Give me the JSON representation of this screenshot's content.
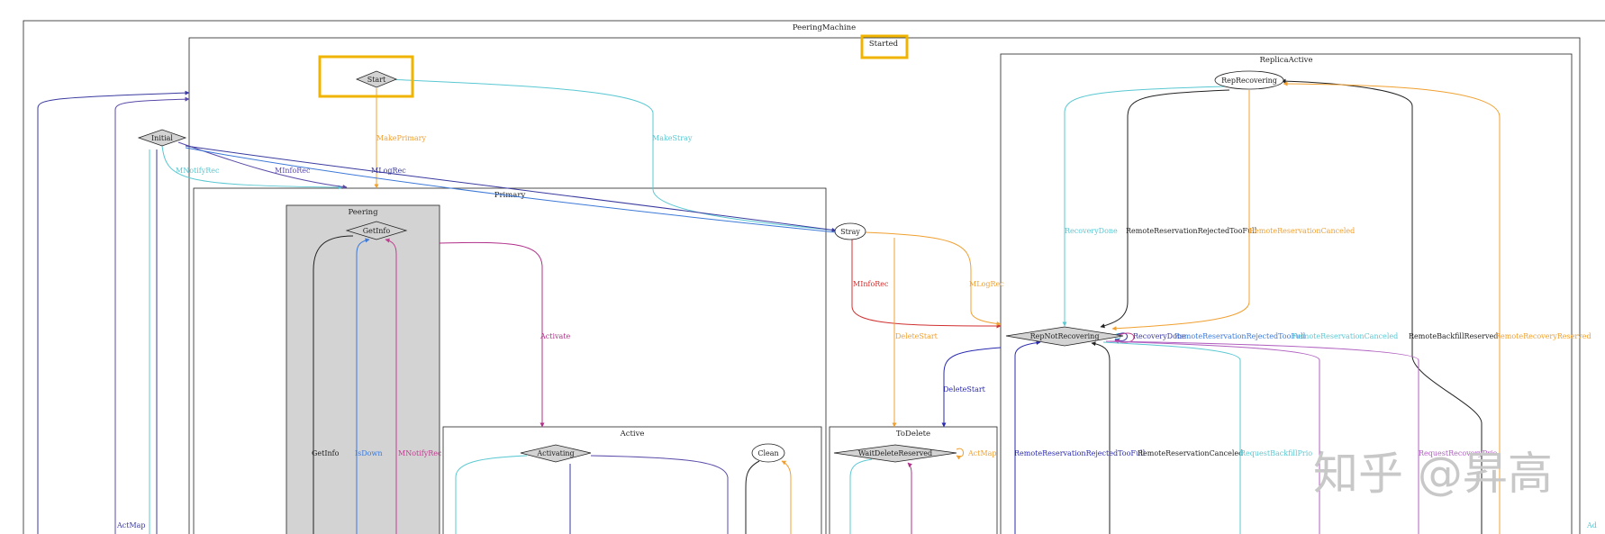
{
  "colors": {
    "highlight": "#f0b400",
    "cyan": "#5ac8d2",
    "orange": "#f0a030",
    "navy": "#3a3aa0",
    "purple": "#5a4aa8",
    "magenta": "#c03c90",
    "red": "#d03030",
    "black": "#222222",
    "blue": "#3c78d8",
    "gray_fill": "#d3d3d3",
    "violet": "#b060c0"
  },
  "clusters": {
    "peering_machine": "PeeringMachine",
    "started": "Started",
    "replica_active": "ReplicaActive",
    "primary": "Primary",
    "peering": "Peering",
    "active": "Active",
    "to_delete": "ToDelete"
  },
  "nodes": {
    "start": "Start",
    "initial": "Initial",
    "get_info": "GetInfo",
    "stray": "Stray",
    "rep_recovering": "RepRecovering",
    "rep_not_recovering": "RepNotRecovering",
    "activating": "Activating",
    "clean": "Clean",
    "wait_delete_reserved": "WaitDeleteReserved"
  },
  "edges": {
    "make_primary": "MakePrimary",
    "make_stray": "MakeStray",
    "mnotify_rec_initial": "MNotifyRec",
    "minfo_rec_initial": "MInfoRec",
    "mlog_rec_initial": "MLogRec",
    "activate": "Activate",
    "get_info_loop": "GetInfo",
    "is_down": "IsDown",
    "mnotify_rec_peering": "MNotifyRec",
    "minfo_rec_stray": "MInfoRec",
    "mlog_rec_stray": "MLogRec",
    "delete_start_stray": "DeleteStart",
    "delete_start_rep": "DeleteStart",
    "act_map_wait": "ActMap",
    "act_map_left": "ActMap",
    "ad_right": "Ad",
    "recovery_done": "RecoveryDone",
    "rr_rejected_toofull_top": "RemoteReservationRejectedTooFull",
    "rr_canceled_top": "RemoteReservationCanceled",
    "self_loop_1": "RecoveryDone",
    "self_loop_2": "RemoteReservationRejectedTooFull",
    "self_loop_3": "RemoteReservationCanceled",
    "remote_backfill_reserved": "RemoteBackfillReserved",
    "remote_recovery_reserved": "RemoteRecoveryReserved",
    "rr_rejected_toofull_bottom": "RemoteReservationRejectedTooFull",
    "rr_canceled_bottom": "RemoteReservationCanceled",
    "request_backfill_prio": "RequestBackfillPrio",
    "request_recovery_prio": "RequestRecoveryPrio"
  },
  "watermark": "知乎 @昇高"
}
